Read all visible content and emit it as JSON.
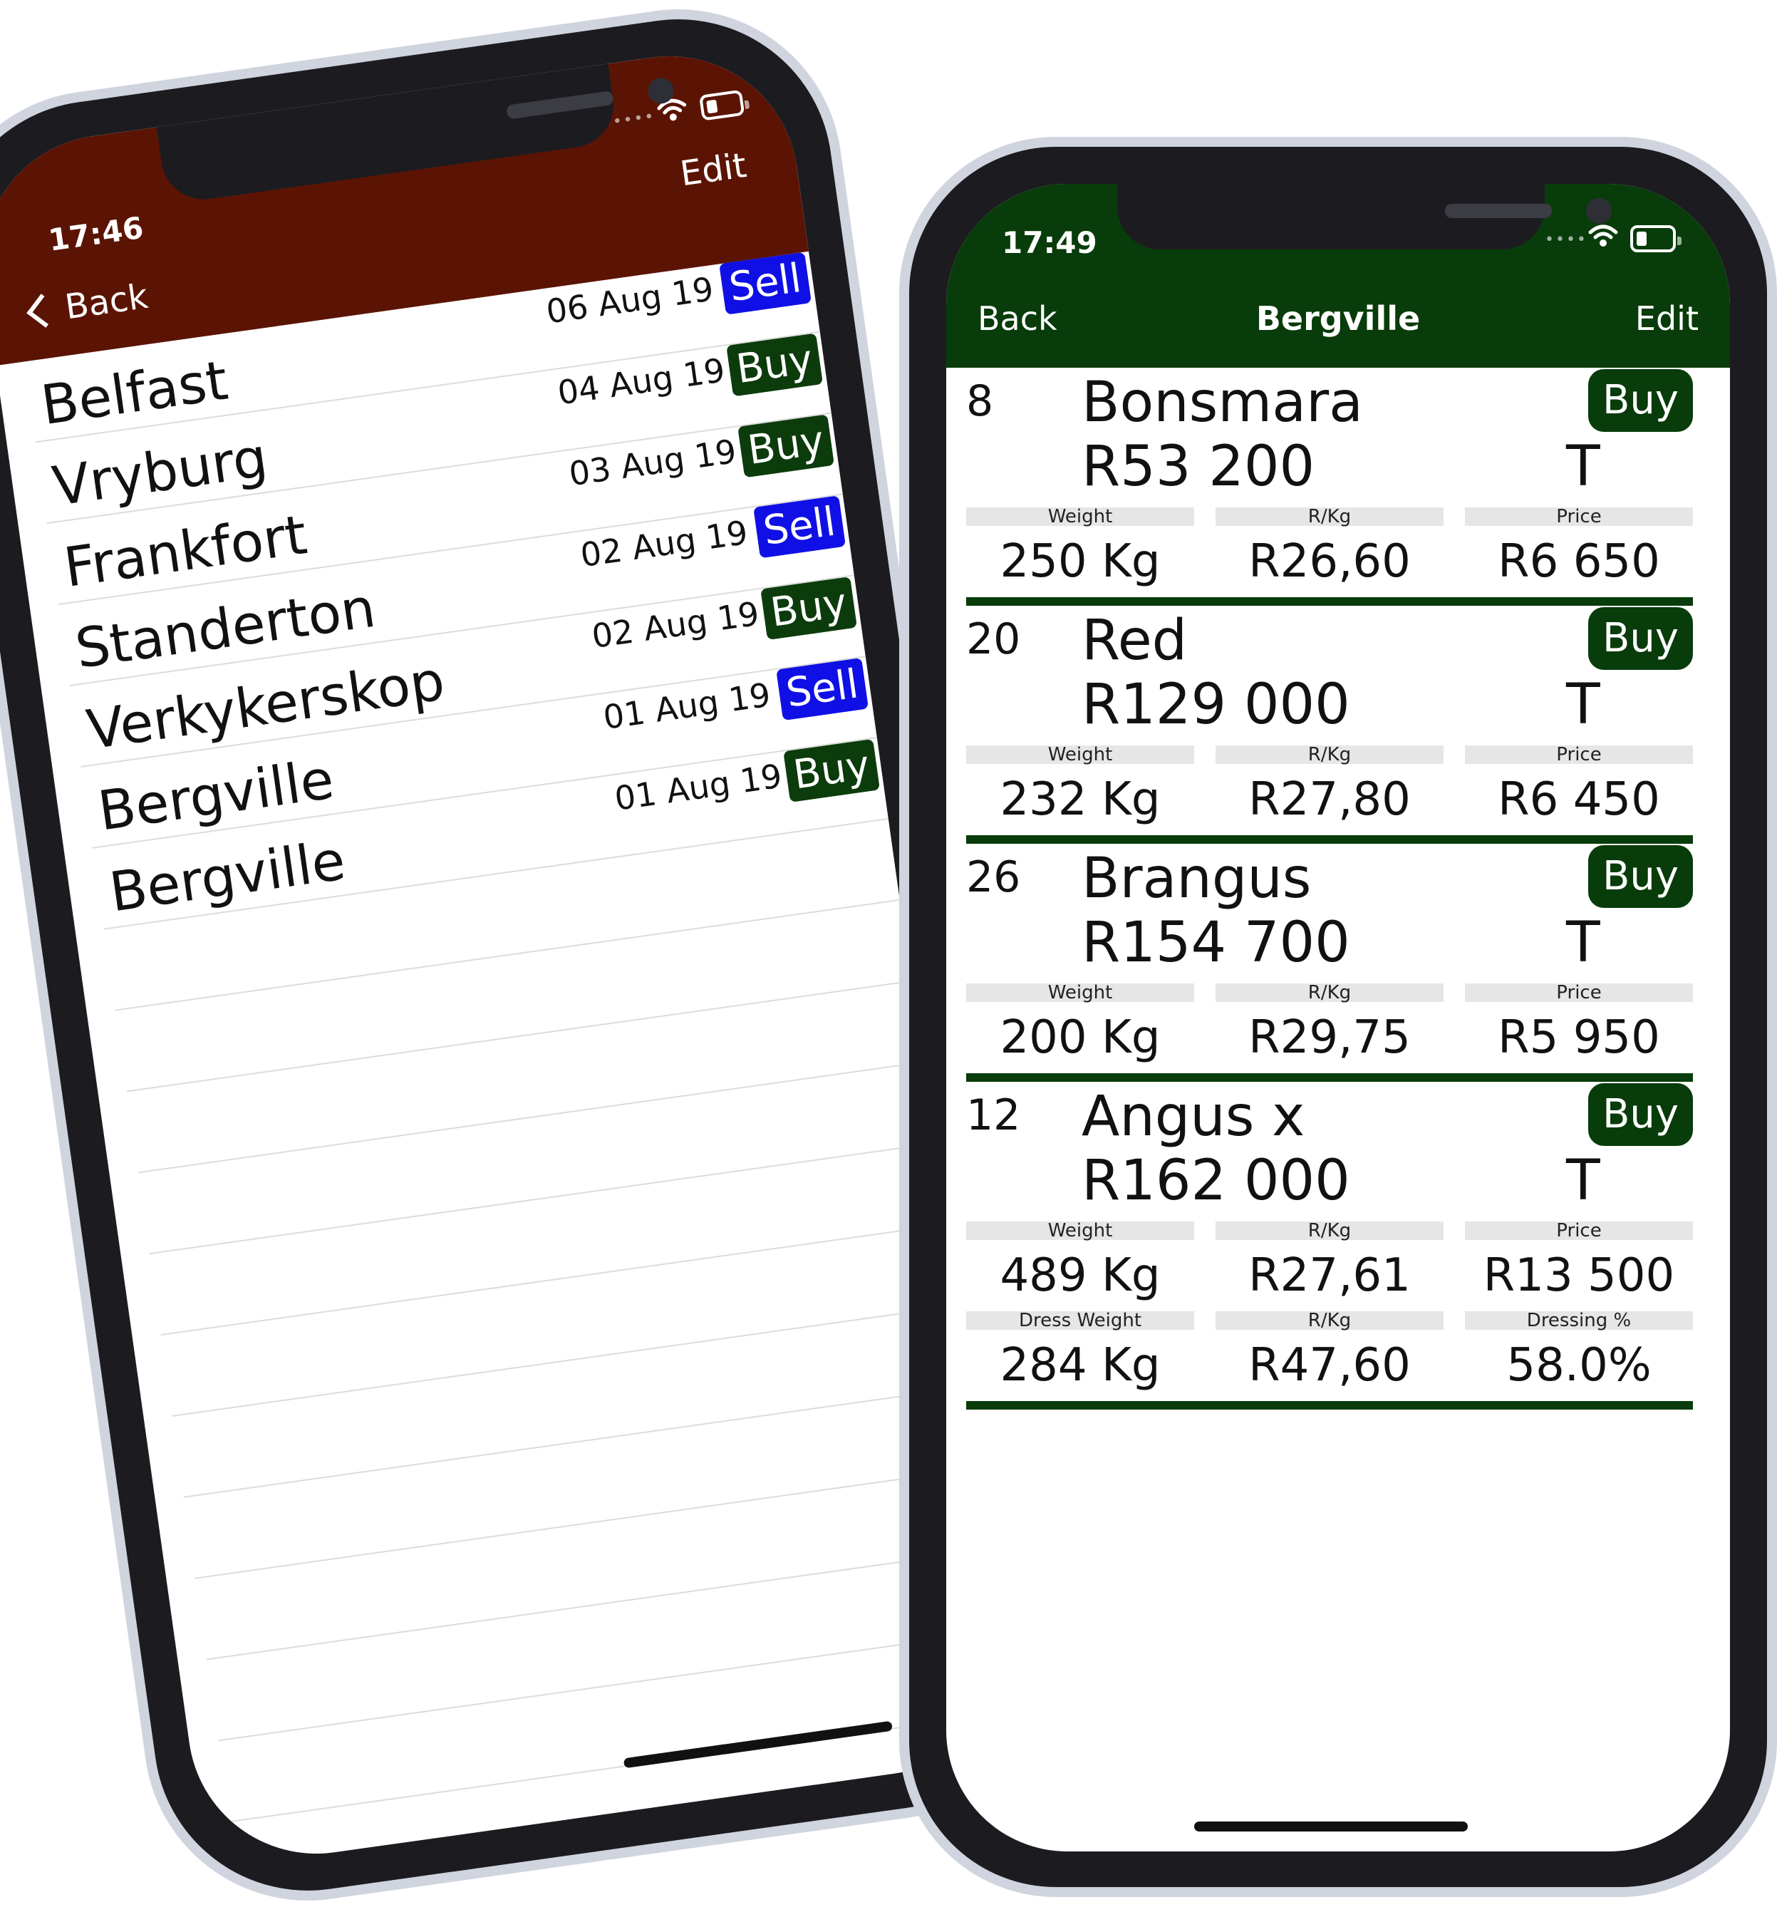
{
  "left_phone": {
    "status_time": "17:46",
    "nav": {
      "back_label": "Back",
      "edit_label": "Edit"
    },
    "colors": {
      "navbar": "#5b1404",
      "sell": "#1010e6",
      "buy": "#0c3c0c"
    },
    "rows": [
      {
        "city": "Belfast",
        "date": "06 Aug 19",
        "tag": "Sell"
      },
      {
        "city": "Vryburg",
        "date": "04 Aug 19",
        "tag": "Buy"
      },
      {
        "city": "Frankfort",
        "date": "03 Aug 19",
        "tag": "Buy"
      },
      {
        "city": "Standerton",
        "date": "02 Aug 19",
        "tag": "Sell"
      },
      {
        "city": "Verkykerskop",
        "date": "02 Aug 19",
        "tag": "Buy"
      },
      {
        "city": "Bergville",
        "date": "01 Aug 19",
        "tag": "Sell"
      },
      {
        "city": "Bergville",
        "date": "01 Aug 19",
        "tag": "Buy"
      }
    ]
  },
  "right_phone": {
    "status_time": "17:49",
    "nav": {
      "back_label": "Back",
      "title": "Bergville",
      "edit_label": "Edit"
    },
    "colors": {
      "navbar": "#083c0a",
      "separator": "#083c0a",
      "label_bg": "#e6e6e6"
    },
    "lots": [
      {
        "count": "8",
        "breed": "Bonsmara",
        "total": "R53 200",
        "unit": "T",
        "action": "Buy",
        "stats": [
          {
            "label": "Weight",
            "value": "250 Kg"
          },
          {
            "label": "R/Kg",
            "value": "R26,60"
          },
          {
            "label": "Price",
            "value": "R6 650"
          }
        ]
      },
      {
        "count": "20",
        "breed": "Red",
        "total": "R129 000",
        "unit": "T",
        "action": "Buy",
        "stats": [
          {
            "label": "Weight",
            "value": "232 Kg"
          },
          {
            "label": "R/Kg",
            "value": "R27,80"
          },
          {
            "label": "Price",
            "value": "R6 450"
          }
        ]
      },
      {
        "count": "26",
        "breed": "Brangus",
        "total": "R154 700",
        "unit": "T",
        "action": "Buy",
        "stats": [
          {
            "label": "Weight",
            "value": "200 Kg"
          },
          {
            "label": "R/Kg",
            "value": "R29,75"
          },
          {
            "label": "Price",
            "value": "R5 950"
          }
        ]
      },
      {
        "count": "12",
        "breed": "Angus x",
        "total": "R162 000",
        "unit": "T",
        "action": "Buy",
        "stats": [
          {
            "label": "Weight",
            "value": "489 Kg"
          },
          {
            "label": "R/Kg",
            "value": "R27,61"
          },
          {
            "label": "Price",
            "value": "R13 500"
          }
        ],
        "dress_stats": [
          {
            "label": "Dress Weight",
            "value": "284 Kg"
          },
          {
            "label": "R/Kg",
            "value": "R47,60"
          },
          {
            "label": "Dressing %",
            "value": "58.0%"
          }
        ]
      }
    ]
  }
}
